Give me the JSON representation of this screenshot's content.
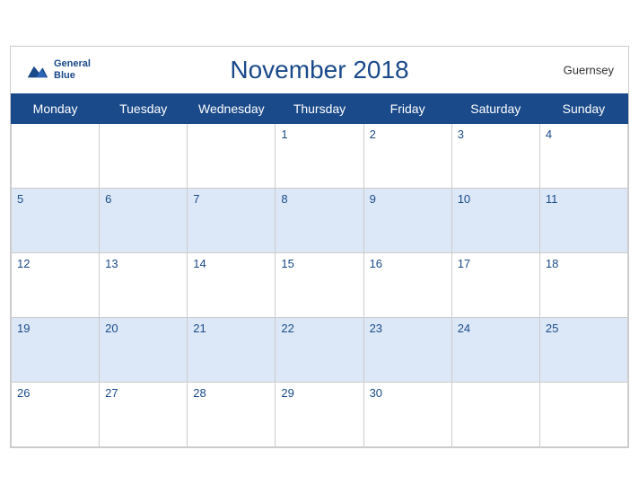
{
  "header": {
    "title": "November 2018",
    "region": "Guernsey",
    "logo_line1": "General",
    "logo_line2": "Blue"
  },
  "weekdays": [
    "Monday",
    "Tuesday",
    "Wednesday",
    "Thursday",
    "Friday",
    "Saturday",
    "Sunday"
  ],
  "weeks": [
    [
      null,
      null,
      null,
      1,
      2,
      3,
      4
    ],
    [
      5,
      6,
      7,
      8,
      9,
      10,
      11
    ],
    [
      12,
      13,
      14,
      15,
      16,
      17,
      18
    ],
    [
      19,
      20,
      21,
      22,
      23,
      24,
      25
    ],
    [
      26,
      27,
      28,
      29,
      30,
      null,
      null
    ]
  ],
  "colors": {
    "header_bg": "#1a4a8a",
    "row_alt": "#dce8f7",
    "text_blue": "#1a4a8a"
  }
}
